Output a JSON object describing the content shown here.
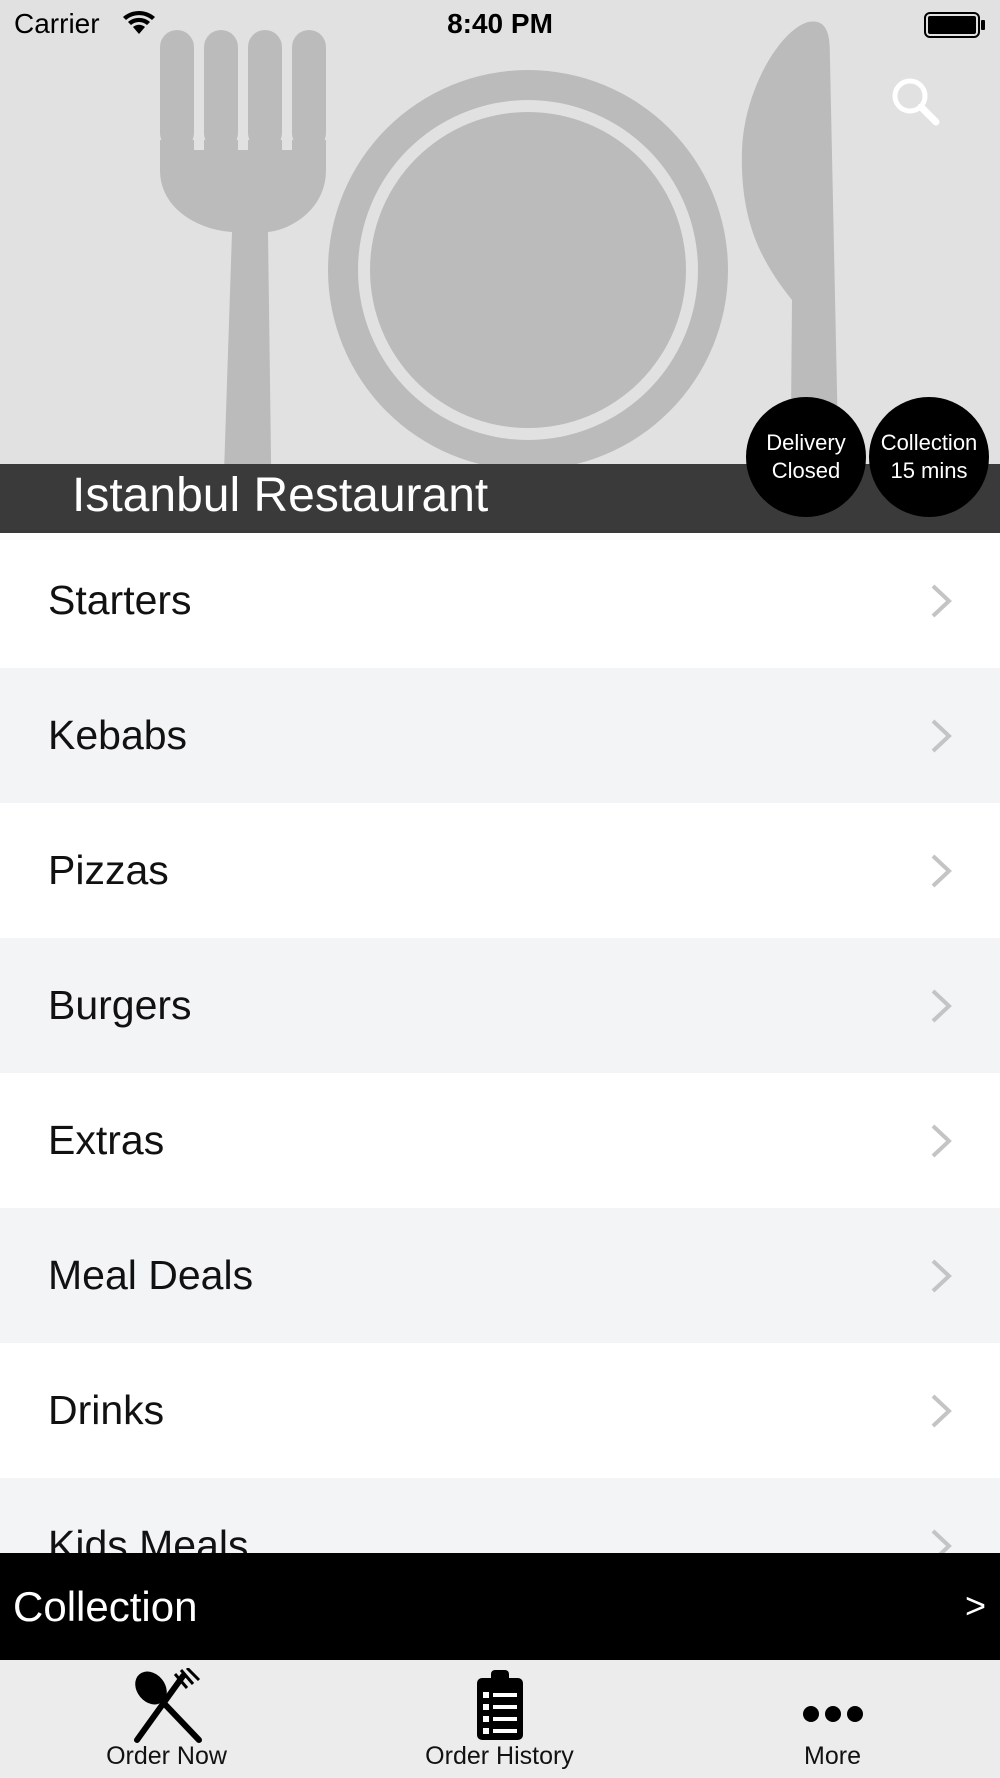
{
  "status_bar": {
    "carrier": "Carrier",
    "time": "8:40 PM"
  },
  "header": {
    "restaurant_name": "Istanbul Restaurant",
    "badges": [
      {
        "line1": "Delivery",
        "line2": "Closed"
      },
      {
        "line1": "Collection",
        "line2": "15 mins"
      }
    ]
  },
  "menu": {
    "categories": [
      "Starters",
      "Kebabs",
      "Pizzas",
      "Burgers",
      "Extras",
      "Meal Deals",
      "Drinks",
      "Kids Meals"
    ]
  },
  "collection_bar": {
    "label": "Collection",
    "arrow": ">"
  },
  "tab_bar": {
    "tabs": [
      {
        "label": "Order Now",
        "icon": "fork-spoon-icon"
      },
      {
        "label": "Order History",
        "icon": "clipboard-icon"
      },
      {
        "label": "More",
        "icon": "more-dots-icon"
      }
    ]
  },
  "colors": {
    "hero_bg": "#e1e1e1",
    "title_bar": "#3a3a3a",
    "row_alt": "#f3f4f6",
    "collection_bar": "#000000",
    "tab_bar": "#ececec"
  }
}
